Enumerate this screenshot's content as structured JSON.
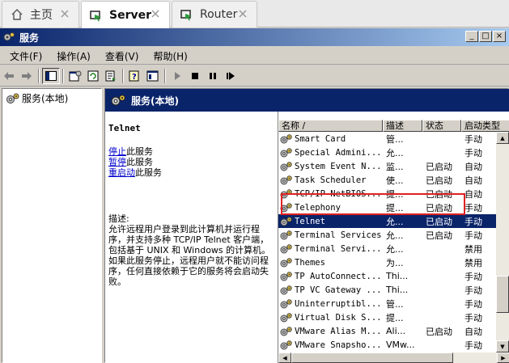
{
  "browser_tabs": [
    {
      "label": "主页",
      "icon": "home-icon",
      "active": false
    },
    {
      "label": "Server",
      "icon": "vm-icon",
      "active": true
    },
    {
      "label": "Router",
      "icon": "vm-icon",
      "active": false
    }
  ],
  "window": {
    "title": "服务",
    "controls": [
      "_",
      "□",
      "×"
    ]
  },
  "menu": [
    {
      "label": "文件(F)"
    },
    {
      "label": "操作(A)"
    },
    {
      "label": "查看(V)"
    },
    {
      "label": "帮助(H)"
    }
  ],
  "tree": {
    "root_label": "服务(本地)"
  },
  "pane": {
    "header": "服务(本地)"
  },
  "detail": {
    "service_name": "Telnet",
    "links": [
      {
        "link": "停止",
        "rest": "此服务"
      },
      {
        "link": "暂停",
        "rest": "此服务"
      },
      {
        "link": "重启动",
        "rest": "此服务"
      }
    ],
    "desc_label": "描述:",
    "description": "允许远程用户登录到此计算机并运行程序，并支持多种 TCP/IP Telnet 客户端，包括基于 UNIX 和 Windows 的计算机。如果此服务停止，远程用户就不能访问程序，任何直接依赖于它的服务将会启动失败。"
  },
  "listview": {
    "columns": [
      "名称 /",
      "描述",
      "状态",
      "启动类型"
    ],
    "rows": [
      {
        "name": "Smart Card",
        "desc": "管...",
        "status": "",
        "startup": "手动"
      },
      {
        "name": "Special Admini...",
        "desc": "允...",
        "status": "",
        "startup": "手动"
      },
      {
        "name": "System Event N...",
        "desc": "监...",
        "status": "已启动",
        "startup": "自动"
      },
      {
        "name": "Task Scheduler",
        "desc": "使...",
        "status": "已启动",
        "startup": "自动"
      },
      {
        "name": "TCP/IP NetBIOS...",
        "desc": "提...",
        "status": "已启动",
        "startup": "自动"
      },
      {
        "name": "Telephony",
        "desc": "提...",
        "status": "已启动",
        "startup": "手动"
      },
      {
        "name": "Telnet",
        "desc": "允...",
        "status": "已启动",
        "startup": "手动"
      },
      {
        "name": "Terminal Services",
        "desc": "允...",
        "status": "已启动",
        "startup": "手动"
      },
      {
        "name": "Terminal Servi...",
        "desc": "允...",
        "status": "",
        "startup": "禁用"
      },
      {
        "name": "Themes",
        "desc": "为...",
        "status": "",
        "startup": "禁用"
      },
      {
        "name": "TP AutoConnect...",
        "desc": "Thi...",
        "status": "",
        "startup": "手动"
      },
      {
        "name": "TP VC Gateway ...",
        "desc": "Thi...",
        "status": "",
        "startup": "手动"
      },
      {
        "name": "Uninterruptibl...",
        "desc": "管...",
        "status": "",
        "startup": "手动"
      },
      {
        "name": "Virtual Disk S...",
        "desc": "提...",
        "status": "",
        "startup": "手动"
      },
      {
        "name": "VMware Alias M...",
        "desc": "Ali...",
        "status": "已启动",
        "startup": "自动"
      },
      {
        "name": "VMware Snapsho...",
        "desc": "VMw...",
        "status": "",
        "startup": "手动"
      }
    ],
    "selected_index": 6
  },
  "colors": {
    "selection": "#0a246a",
    "highlight_box": "#e02020",
    "link": "#0000cc"
  }
}
